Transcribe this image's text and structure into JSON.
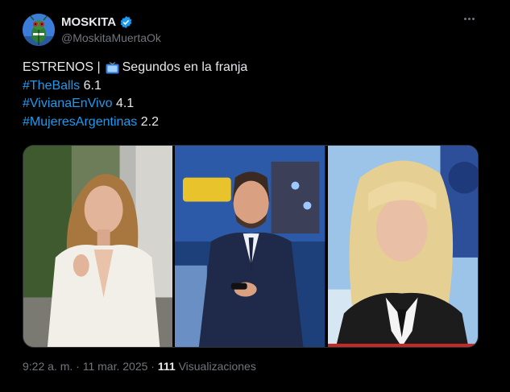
{
  "author": {
    "name": "MOSKITA",
    "handle": "@MoskitaMuertaOk",
    "verified_color": "#1d9bf0"
  },
  "tweet": {
    "line1_prefix": "ESTRENOS |",
    "line1_icon": "tv-icon",
    "line1_suffix": "Segundos en la franja",
    "rows": [
      {
        "tag": "#TheBalls",
        "value": "6.1"
      },
      {
        "tag": "#VivianaEnVivo",
        "value": "4.1"
      },
      {
        "tag": "#MujeresArgentinas",
        "value": "2.2"
      }
    ]
  },
  "media": {
    "images": [
      "woman-host-photo",
      "man-host-photo",
      "blonde-host-photo"
    ]
  },
  "meta": {
    "time": "9:22 a. m.",
    "sep1": "·",
    "date": "11 mar. 2025",
    "sep2": "·",
    "views_count": "111",
    "views_label": "Visualizaciones"
  },
  "colors": {
    "background": "#000000",
    "text": "#e7e9ea",
    "link": "#1d9bf0",
    "muted": "#71767b"
  }
}
